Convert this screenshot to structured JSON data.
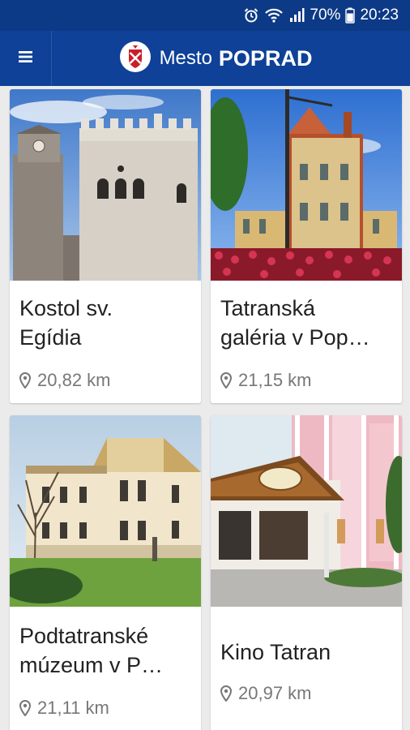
{
  "status": {
    "battery": "70%",
    "time": "20:23"
  },
  "header": {
    "title_prefix": "Mesto",
    "title_name": "POPRAD"
  },
  "places": [
    {
      "title_line1": "Kostol sv.",
      "title_line2": "Egídia",
      "distance": "20,82 km"
    },
    {
      "title_line1": "Tatranská",
      "title_line2": "galéria v Pop…",
      "distance": "21,15 km"
    },
    {
      "title_line1": "Podtatranské",
      "title_line2": "múzeum v P…",
      "distance": "21,11 km"
    },
    {
      "title_line1": "Kino Tatran",
      "title_line2": "",
      "distance": "20,97 km"
    }
  ],
  "colors": {
    "status_bar": "#0d3a86",
    "app_bar": "#0e4197",
    "background": "#ebebeb",
    "card": "#ffffff"
  },
  "icons": {
    "menu": "hamburger-menu-icon",
    "logo": "city-coat-of-arms-logo",
    "distance": "location-pin-icon",
    "alarm": "alarm-clock-icon",
    "wifi": "wifi-icon",
    "signal": "signal-bars-icon",
    "battery": "battery-icon"
  }
}
